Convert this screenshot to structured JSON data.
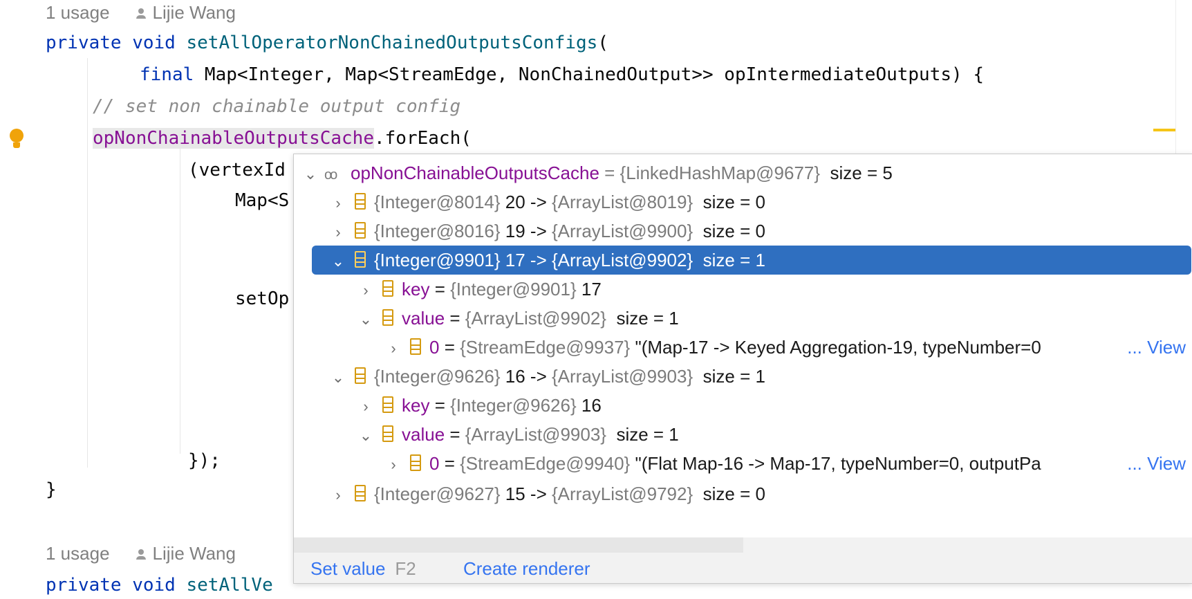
{
  "editor": {
    "hint_top": {
      "usages": "1 usage",
      "author": "Lijie Wang"
    },
    "line1": {
      "kw": "private void",
      "fn": "setAllOperatorNonChainedOutputsConfigs",
      "tail": "("
    },
    "line2": {
      "kw": "final",
      "tail": " Map<Integer, Map<StreamEdge, NonChainedOutput>> opIntermediateOutputs) {"
    },
    "line3": {
      "comment": "// set non chainable output config"
    },
    "line4": {
      "field": "opNonChainableOutputsCache",
      "tail": ".forEach("
    },
    "line5": {
      "text": "(vertexId"
    },
    "line6": {
      "text": "Map<S"
    },
    "line7": {
      "text": "setOp"
    },
    "line8": {
      "text": "});"
    },
    "line9": {
      "text": "}"
    },
    "hint_bottom": {
      "usages": "1 usage",
      "author": "Lijie Wang"
    },
    "line10": {
      "kw": "private void",
      "fn": "setAllVe"
    }
  },
  "debug_popup": {
    "root": {
      "name": "opNonChainableOutputsCache",
      "ref": " = {LinkedHashMap@9677}",
      "size": "size = 5"
    },
    "rows": [
      {
        "ref": "{Integer@8014}",
        "entry": " 20 -> ",
        "ref2": "{ArrayList@8019}",
        "size": "size = 0",
        "expanded": false
      },
      {
        "ref": "{Integer@8016}",
        "entry": " 19 -> ",
        "ref2": "{ArrayList@9900}",
        "size": "size = 0",
        "expanded": false
      },
      {
        "ref": "{Integer@9901}",
        "entry": " 17 -> ",
        "ref2": "{ArrayList@9902}",
        "size": "size = 1",
        "expanded": true,
        "selected": true
      },
      {
        "name": "key",
        "eq": " = ",
        "ref": "{Integer@9901}",
        "value": " 17"
      },
      {
        "name": "value",
        "eq": " = ",
        "ref": "{ArrayList@9902}",
        "size": "size = 1"
      },
      {
        "name": "0",
        "eq": " = ",
        "ref": "{StreamEdge@9937}",
        "value": " \"(Map-17 -> Keyed Aggregation-19, typeNumber=0",
        "link": "... View"
      },
      {
        "ref": "{Integer@9626}",
        "entry": " 16 -> ",
        "ref2": "{ArrayList@9903}",
        "size": "size = 1",
        "expanded": true
      },
      {
        "name": "key",
        "eq": " = ",
        "ref": "{Integer@9626}",
        "value": " 16"
      },
      {
        "name": "value",
        "eq": " = ",
        "ref": "{ArrayList@9903}",
        "size": "size = 1"
      },
      {
        "name": "0",
        "eq": " = ",
        "ref": "{StreamEdge@9940}",
        "value": " \"(Flat Map-16 -> Map-17, typeNumber=0, outputPa",
        "link": "... View"
      },
      {
        "ref": "{Integer@9627}",
        "entry": " 15 -> ",
        "ref2": "{ArrayList@9792}",
        "size": "size = 0",
        "expanded": false
      }
    ],
    "footer": {
      "set_value": "Set value",
      "set_value_shortcut": "F2",
      "create_renderer": "Create renderer"
    },
    "icons": {
      "expanded": "chevron-down-icon",
      "collapsed": "chevron-right-icon",
      "object": "object-icon",
      "watch": "watch-glasses-icon"
    }
  }
}
